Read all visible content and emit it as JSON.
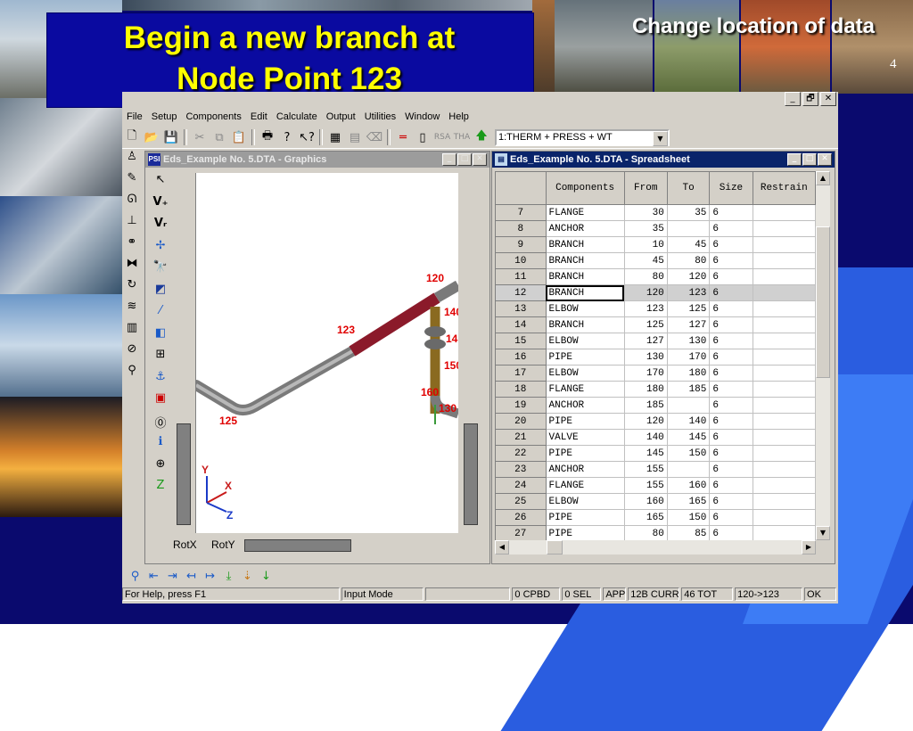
{
  "slide": {
    "title_line1": "Begin a new branch at",
    "title_line2": "Node Point 123",
    "subtitle": "Change location of data",
    "page_number": "4"
  },
  "app": {
    "menu": [
      "File",
      "Setup",
      "Components",
      "Edit",
      "Calculate",
      "Output",
      "Utilities",
      "Window",
      "Help"
    ],
    "load_case": "1:THERM + PRESS + WT",
    "window_buttons": [
      "_",
      "🗗",
      "✕"
    ]
  },
  "graphics": {
    "title": "Eds_Example No. 5.DTA - Graphics",
    "icon_text": "PSI",
    "node_labels": [
      "120",
      "123",
      "125",
      "140",
      "145",
      "150",
      "160",
      "130"
    ],
    "axis_labels": [
      "Y",
      "X",
      "Z"
    ],
    "rot_x_label": "RotX",
    "rot_y_label": "RotY"
  },
  "spreadsheet": {
    "title": "Eds_Example No. 5.DTA - Spreadsheet",
    "columns": [
      "Components",
      "From",
      "To",
      "Size",
      "Restrain"
    ],
    "rows": [
      {
        "n": "7",
        "comp": "FLANGE",
        "from": "30",
        "to": "35",
        "size": "6"
      },
      {
        "n": "8",
        "comp": "ANCHOR",
        "from": "35",
        "to": "",
        "size": "6"
      },
      {
        "n": "9",
        "comp": "BRANCH",
        "from": "10",
        "to": "45",
        "size": "6"
      },
      {
        "n": "10",
        "comp": "BRANCH",
        "from": "45",
        "to": "80",
        "size": "6"
      },
      {
        "n": "11",
        "comp": "BRANCH",
        "from": "80",
        "to": "120",
        "size": "6"
      },
      {
        "n": "12",
        "comp": "BRANCH",
        "from": "120",
        "to": "123",
        "size": "6"
      },
      {
        "n": "13",
        "comp": "ELBOW",
        "from": "123",
        "to": "125",
        "size": "6"
      },
      {
        "n": "14",
        "comp": "BRANCH",
        "from": "125",
        "to": "127",
        "size": "6"
      },
      {
        "n": "15",
        "comp": "ELBOW",
        "from": "127",
        "to": "130",
        "size": "6"
      },
      {
        "n": "16",
        "comp": "PIPE",
        "from": "130",
        "to": "170",
        "size": "6"
      },
      {
        "n": "17",
        "comp": "ELBOW",
        "from": "170",
        "to": "180",
        "size": "6"
      },
      {
        "n": "18",
        "comp": "FLANGE",
        "from": "180",
        "to": "185",
        "size": "6"
      },
      {
        "n": "19",
        "comp": "ANCHOR",
        "from": "185",
        "to": "",
        "size": "6"
      },
      {
        "n": "20",
        "comp": "PIPE",
        "from": "120",
        "to": "140",
        "size": "6"
      },
      {
        "n": "21",
        "comp": "VALVE",
        "from": "140",
        "to": "145",
        "size": "6"
      },
      {
        "n": "22",
        "comp": "PIPE",
        "from": "145",
        "to": "150",
        "size": "6"
      },
      {
        "n": "23",
        "comp": "ANCHOR",
        "from": "155",
        "to": "",
        "size": "6"
      },
      {
        "n": "24",
        "comp": "FLANGE",
        "from": "155",
        "to": "160",
        "size": "6"
      },
      {
        "n": "25",
        "comp": "ELBOW",
        "from": "160",
        "to": "165",
        "size": "6"
      },
      {
        "n": "26",
        "comp": "PIPE",
        "from": "165",
        "to": "150",
        "size": "6"
      },
      {
        "n": "27",
        "comp": "PIPE",
        "from": "80",
        "to": "85",
        "size": "6"
      }
    ],
    "selected_row": "12"
  },
  "statusbar": {
    "help": "For Help, press F1",
    "mode": "Input Mode",
    "blank": "",
    "cpbd": "0 CPBD",
    "sel": "0 SEL",
    "app": "APP",
    "curr": "12B CURR",
    "tot": "46 TOT",
    "range": "120->123",
    "ok": "OK"
  },
  "colors": {
    "slide_background": "#0a0a6e",
    "title_yellow": "#ffff00",
    "active_titlebar": "#0a246a",
    "pipe_highlight": "#8b1a2a",
    "node_label_red": "#e00000"
  }
}
